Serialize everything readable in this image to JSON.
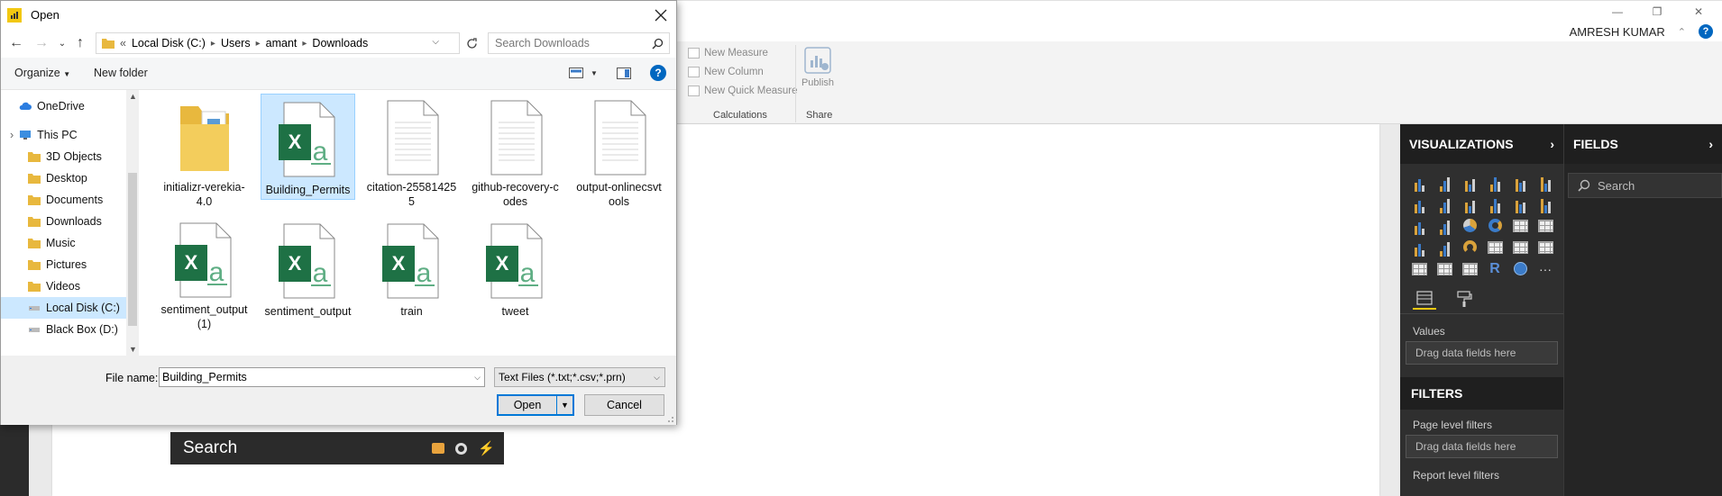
{
  "app": {
    "user_name": "AMRESH KUMAR",
    "help_glyph": "?",
    "ribbon": {
      "new_measure": "New Measure",
      "new_column": "New Column",
      "new_quick_measure": "New Quick Measure",
      "calculations_label": "Calculations",
      "publish_label": "Publish",
      "share_label": "Share"
    },
    "visualizations": {
      "title": "VISUALIZATIONS",
      "values_label": "Values",
      "values_drop": "Drag data fields here",
      "filters_title": "FILTERS",
      "page_filters": "Page level filters",
      "page_filters_drop": "Drag data fields here",
      "report_filters": "Report level filters",
      "r_glyph": "R",
      "more_glyph": "···"
    },
    "fields": {
      "title": "FIELDS",
      "search_placeholder": "Search"
    },
    "taskbar_search": {
      "placeholder": "Search"
    },
    "colors": {
      "accent_yellow": "#f2c811",
      "pane_dark": "#2f2f2f",
      "selection_blue": "#cce8ff",
      "focus_blue": "#0078d7",
      "excel_green": "#1e7145"
    }
  },
  "dialog": {
    "title": "Open",
    "breadcrumb": [
      "Local Disk (C:)",
      "Users",
      "amant",
      "Downloads"
    ],
    "breadcrumb_prefix": "«",
    "search_placeholder": "Search Downloads",
    "organize_label": "Organize",
    "new_folder_label": "New folder",
    "nav_items": [
      {
        "label": "OneDrive",
        "icon": "cloud-icon"
      },
      {
        "label": "This PC",
        "icon": "computer-icon"
      },
      {
        "label": "3D Objects",
        "icon": "folder-icon"
      },
      {
        "label": "Desktop",
        "icon": "folder-icon"
      },
      {
        "label": "Documents",
        "icon": "folder-icon"
      },
      {
        "label": "Downloads",
        "icon": "folder-icon"
      },
      {
        "label": "Music",
        "icon": "folder-icon"
      },
      {
        "label": "Pictures",
        "icon": "folder-icon"
      },
      {
        "label": "Videos",
        "icon": "folder-icon"
      },
      {
        "label": "Local Disk (C:)",
        "icon": "drive-icon",
        "selected": true
      },
      {
        "label": "Black Box (D:)",
        "icon": "drive-icon"
      }
    ],
    "files": [
      {
        "name": "initializr-verekia-4.0",
        "type": "folder"
      },
      {
        "name": "Building_Permits",
        "type": "excel",
        "selected": true
      },
      {
        "name": "citation-255814255",
        "type": "text"
      },
      {
        "name": "github-recovery-codes",
        "type": "text"
      },
      {
        "name": "output-onlinecsvtools",
        "type": "text"
      },
      {
        "name": "sentiment_output (1)",
        "type": "excel"
      },
      {
        "name": "sentiment_output",
        "type": "excel"
      },
      {
        "name": "train",
        "type": "excel"
      },
      {
        "name": "tweet",
        "type": "excel"
      }
    ],
    "file_name_label": "File name:",
    "file_name_value": "Building_Permits",
    "file_type_value": "Text Files (*.txt;*.csv;*.prn)",
    "open_label": "Open",
    "cancel_label": "Cancel"
  }
}
